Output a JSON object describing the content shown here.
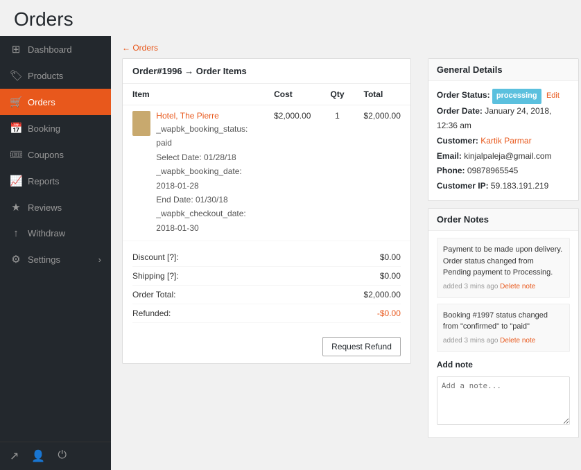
{
  "page": {
    "title": "Orders"
  },
  "sidebar": {
    "items": [
      {
        "id": "dashboard",
        "label": "Dashboard",
        "icon": "⊞",
        "active": false
      },
      {
        "id": "products",
        "label": "Products",
        "icon": "🏷",
        "active": false
      },
      {
        "id": "orders",
        "label": "Orders",
        "icon": "🛒",
        "active": true
      },
      {
        "id": "booking",
        "label": "Booking",
        "icon": "📅",
        "active": false
      },
      {
        "id": "coupons",
        "label": "Coupons",
        "icon": "🎟",
        "active": false
      },
      {
        "id": "reports",
        "label": "Reports",
        "icon": "📈",
        "active": false
      },
      {
        "id": "reviews",
        "label": "Reviews",
        "icon": "★",
        "active": false
      },
      {
        "id": "withdraw",
        "label": "Withdraw",
        "icon": "↑",
        "active": false
      },
      {
        "id": "settings",
        "label": "Settings",
        "icon": "⚙",
        "active": false,
        "arrow": "›"
      }
    ],
    "bottom_icons": [
      "↗",
      "👤",
      "⏻"
    ]
  },
  "breadcrumb": "Orders",
  "order": {
    "header": "Order#1996 → Order Items",
    "table": {
      "columns": [
        "Item",
        "Cost",
        "Qty",
        "Total"
      ],
      "rows": [
        {
          "item_name": "Hotel, The Pierre",
          "item_meta": "_wapbk_booking_status: paid\n\nSelect Date: 01/28/18\n\n_wapbk_booking_date: 2018-01-28\n\nEnd Date: 01/30/18\n\n_wapbk_checkout_date: 2018-01-30",
          "cost": "$2,000.00",
          "qty": "1",
          "total": "$2,000.00"
        }
      ]
    },
    "totals": [
      {
        "label": "Discount [?]:",
        "value": "$0.00",
        "type": "normal"
      },
      {
        "label": "Shipping [?]:",
        "value": "$0.00",
        "type": "normal"
      },
      {
        "label": "Order Total:",
        "value": "$2,000.00",
        "type": "normal"
      },
      {
        "label": "Refunded:",
        "value": "-$0.00",
        "type": "refund"
      }
    ],
    "refund_button": "Request Refund"
  },
  "general_details": {
    "header": "General Details",
    "order_status_label": "Order Status:",
    "order_status_value": "processing",
    "edit_label": "Edit",
    "order_date_label": "Order Date:",
    "order_date_value": "January 24, 2018, 12:36 am",
    "customer_label": "Customer:",
    "customer_value": "Kartik Parmar",
    "email_label": "Email:",
    "email_value": "kinjalpaleja@gmail.com",
    "phone_label": "Phone:",
    "phone_value": "09878965545",
    "customer_ip_label": "Customer IP:",
    "customer_ip_value": "59.183.191.219"
  },
  "order_notes": {
    "header": "Order Notes",
    "notes": [
      {
        "text": "Payment to be made upon delivery. Order status changed from Pending payment to Processing.",
        "meta": "added 3 mins ago",
        "delete_label": "Delete note"
      },
      {
        "text": "Booking #1997 status changed from \"confirmed\" to \"paid\"",
        "meta": "added 3 mins ago",
        "delete_label": "Delete note"
      }
    ],
    "add_note_label": "Add note"
  }
}
